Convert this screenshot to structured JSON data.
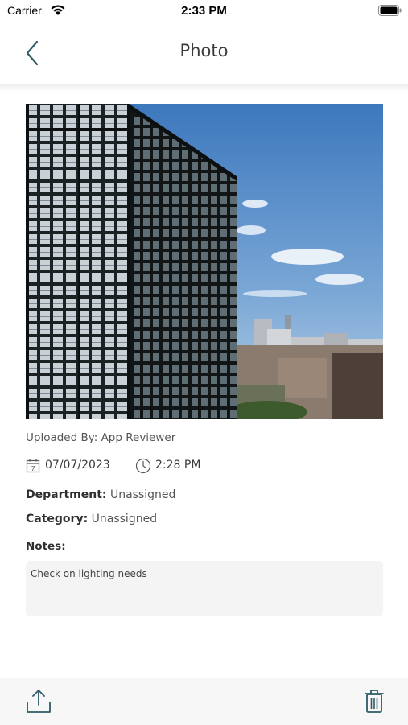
{
  "status": {
    "carrier": "Carrier",
    "time": "2:33 PM"
  },
  "nav": {
    "title": "Photo"
  },
  "photo": {
    "uploaded_by": "Uploaded By: App Reviewer",
    "date": "07/07/2023",
    "time": "2:28 PM"
  },
  "fields": {
    "department_label": "Department:",
    "department_value": " Unassigned",
    "category_label": "Category:",
    "category_value": " Unassigned",
    "notes_label": "Notes:",
    "notes_value": "Check on lighting needs"
  },
  "calendar_day": "7",
  "colors": {
    "accent": "#2e5b67",
    "background": "#ffffff",
    "notes_bg": "#f4f4f4",
    "sky": "#4f87c3"
  },
  "icons": [
    "wifi-icon",
    "battery-icon",
    "back-chevron-icon",
    "calendar-icon",
    "clock-icon",
    "share-icon",
    "trash-icon"
  ]
}
